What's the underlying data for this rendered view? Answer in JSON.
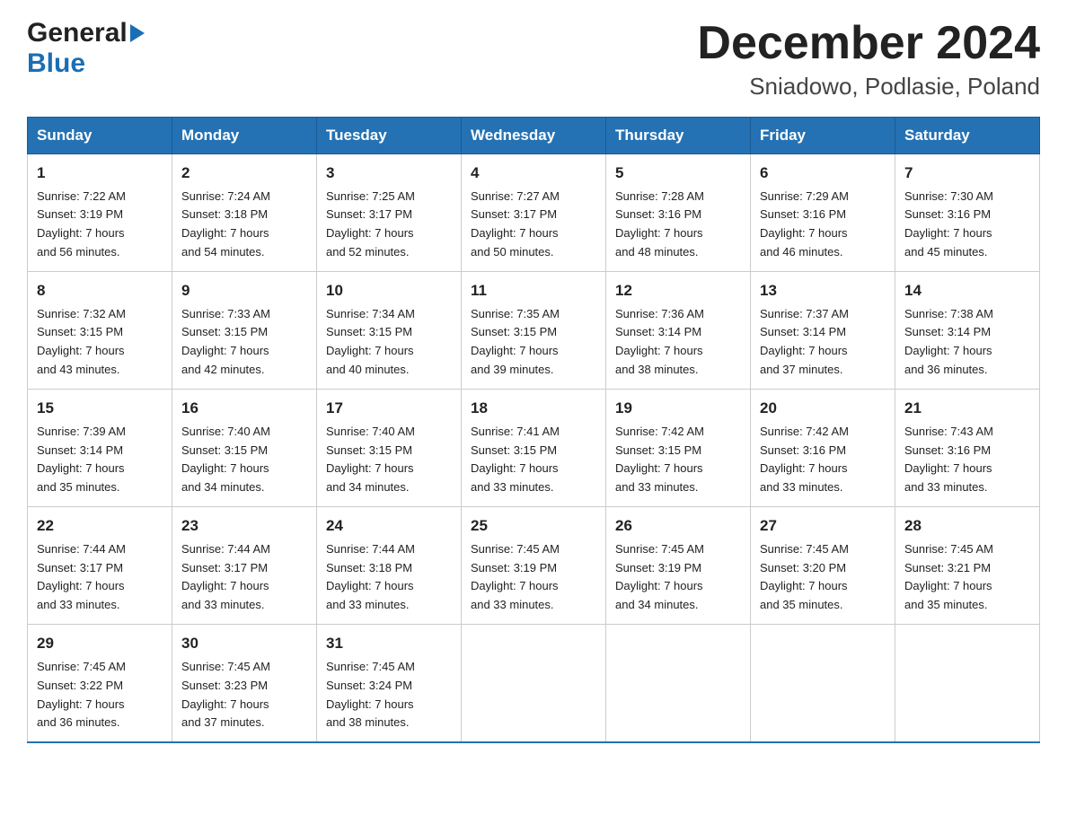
{
  "header": {
    "month_title": "December 2024",
    "location": "Sniadowo, Podlasie, Poland",
    "logo_general": "General",
    "logo_blue": "Blue"
  },
  "days_of_week": [
    "Sunday",
    "Monday",
    "Tuesday",
    "Wednesday",
    "Thursday",
    "Friday",
    "Saturday"
  ],
  "weeks": [
    [
      {
        "day": "1",
        "sunrise": "7:22 AM",
        "sunset": "3:19 PM",
        "daylight": "7 hours and 56 minutes."
      },
      {
        "day": "2",
        "sunrise": "7:24 AM",
        "sunset": "3:18 PM",
        "daylight": "7 hours and 54 minutes."
      },
      {
        "day": "3",
        "sunrise": "7:25 AM",
        "sunset": "3:17 PM",
        "daylight": "7 hours and 52 minutes."
      },
      {
        "day": "4",
        "sunrise": "7:27 AM",
        "sunset": "3:17 PM",
        "daylight": "7 hours and 50 minutes."
      },
      {
        "day": "5",
        "sunrise": "7:28 AM",
        "sunset": "3:16 PM",
        "daylight": "7 hours and 48 minutes."
      },
      {
        "day": "6",
        "sunrise": "7:29 AM",
        "sunset": "3:16 PM",
        "daylight": "7 hours and 46 minutes."
      },
      {
        "day": "7",
        "sunrise": "7:30 AM",
        "sunset": "3:16 PM",
        "daylight": "7 hours and 45 minutes."
      }
    ],
    [
      {
        "day": "8",
        "sunrise": "7:32 AM",
        "sunset": "3:15 PM",
        "daylight": "7 hours and 43 minutes."
      },
      {
        "day": "9",
        "sunrise": "7:33 AM",
        "sunset": "3:15 PM",
        "daylight": "7 hours and 42 minutes."
      },
      {
        "day": "10",
        "sunrise": "7:34 AM",
        "sunset": "3:15 PM",
        "daylight": "7 hours and 40 minutes."
      },
      {
        "day": "11",
        "sunrise": "7:35 AM",
        "sunset": "3:15 PM",
        "daylight": "7 hours and 39 minutes."
      },
      {
        "day": "12",
        "sunrise": "7:36 AM",
        "sunset": "3:14 PM",
        "daylight": "7 hours and 38 minutes."
      },
      {
        "day": "13",
        "sunrise": "7:37 AM",
        "sunset": "3:14 PM",
        "daylight": "7 hours and 37 minutes."
      },
      {
        "day": "14",
        "sunrise": "7:38 AM",
        "sunset": "3:14 PM",
        "daylight": "7 hours and 36 minutes."
      }
    ],
    [
      {
        "day": "15",
        "sunrise": "7:39 AM",
        "sunset": "3:14 PM",
        "daylight": "7 hours and 35 minutes."
      },
      {
        "day": "16",
        "sunrise": "7:40 AM",
        "sunset": "3:15 PM",
        "daylight": "7 hours and 34 minutes."
      },
      {
        "day": "17",
        "sunrise": "7:40 AM",
        "sunset": "3:15 PM",
        "daylight": "7 hours and 34 minutes."
      },
      {
        "day": "18",
        "sunrise": "7:41 AM",
        "sunset": "3:15 PM",
        "daylight": "7 hours and 33 minutes."
      },
      {
        "day": "19",
        "sunrise": "7:42 AM",
        "sunset": "3:15 PM",
        "daylight": "7 hours and 33 minutes."
      },
      {
        "day": "20",
        "sunrise": "7:42 AM",
        "sunset": "3:16 PM",
        "daylight": "7 hours and 33 minutes."
      },
      {
        "day": "21",
        "sunrise": "7:43 AM",
        "sunset": "3:16 PM",
        "daylight": "7 hours and 33 minutes."
      }
    ],
    [
      {
        "day": "22",
        "sunrise": "7:44 AM",
        "sunset": "3:17 PM",
        "daylight": "7 hours and 33 minutes."
      },
      {
        "day": "23",
        "sunrise": "7:44 AM",
        "sunset": "3:17 PM",
        "daylight": "7 hours and 33 minutes."
      },
      {
        "day": "24",
        "sunrise": "7:44 AM",
        "sunset": "3:18 PM",
        "daylight": "7 hours and 33 minutes."
      },
      {
        "day": "25",
        "sunrise": "7:45 AM",
        "sunset": "3:19 PM",
        "daylight": "7 hours and 33 minutes."
      },
      {
        "day": "26",
        "sunrise": "7:45 AM",
        "sunset": "3:19 PM",
        "daylight": "7 hours and 34 minutes."
      },
      {
        "day": "27",
        "sunrise": "7:45 AM",
        "sunset": "3:20 PM",
        "daylight": "7 hours and 35 minutes."
      },
      {
        "day": "28",
        "sunrise": "7:45 AM",
        "sunset": "3:21 PM",
        "daylight": "7 hours and 35 minutes."
      }
    ],
    [
      {
        "day": "29",
        "sunrise": "7:45 AM",
        "sunset": "3:22 PM",
        "daylight": "7 hours and 36 minutes."
      },
      {
        "day": "30",
        "sunrise": "7:45 AM",
        "sunset": "3:23 PM",
        "daylight": "7 hours and 37 minutes."
      },
      {
        "day": "31",
        "sunrise": "7:45 AM",
        "sunset": "3:24 PM",
        "daylight": "7 hours and 38 minutes."
      },
      null,
      null,
      null,
      null
    ]
  ],
  "labels": {
    "sunrise": "Sunrise: ",
    "sunset": "Sunset: ",
    "daylight": "Daylight: "
  }
}
